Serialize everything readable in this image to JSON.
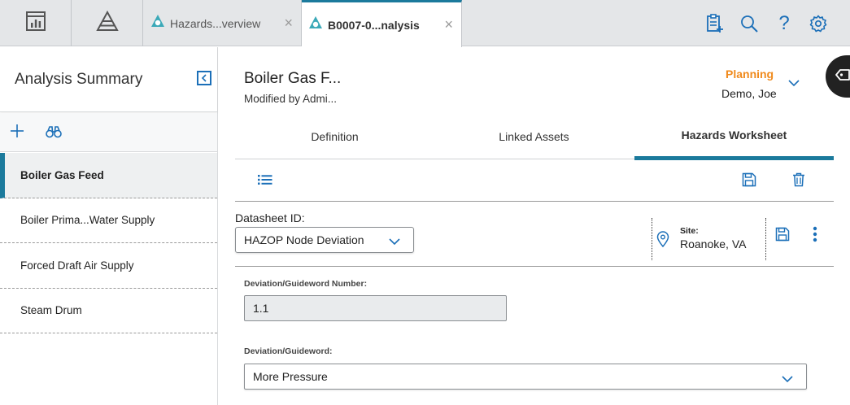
{
  "topbar": {
    "icon_tabs": [
      {
        "icon": "dashboard-icon"
      },
      {
        "icon": "hierarchy-icon"
      }
    ],
    "doc_tabs": [
      {
        "label": "Hazards...verview",
        "icon": "hazards-app-icon",
        "active": false
      },
      {
        "label": "B0007-0...nalysis",
        "icon": "hazards-app-icon",
        "active": true
      }
    ],
    "close_glyph": "×",
    "right_icons": [
      "add-report-icon",
      "search-icon",
      "help-icon",
      "gear-icon"
    ],
    "help_glyph": "?"
  },
  "left_panel": {
    "title": "Analysis Summary",
    "items": [
      {
        "label": "Boiler Gas Feed",
        "selected": true
      },
      {
        "label": "Boiler Prima...Water Supply",
        "selected": false
      },
      {
        "label": "Forced Draft Air Supply",
        "selected": false
      },
      {
        "label": "Steam Drum",
        "selected": false
      }
    ]
  },
  "record": {
    "title": "Boiler Gas F...",
    "subtitle": "Modified by Admi...",
    "state": "Planning",
    "state_user": "Demo, Joe"
  },
  "tabs": [
    {
      "label": "Definition",
      "active": false
    },
    {
      "label": "Linked Assets",
      "active": false
    },
    {
      "label": "Hazards Worksheet",
      "active": true
    }
  ],
  "datasheet": {
    "label": "Datasheet ID:",
    "value": "HAZOP Node Deviation",
    "site_label": "Site:",
    "site_value": "Roanoke, VA"
  },
  "fields": {
    "deviation_number_label": "Deviation/Guideword Number:",
    "deviation_number_value": "1.1",
    "deviation_label": "Deviation/Guideword:",
    "deviation_value": "More Pressure"
  },
  "colors": {
    "accent": "#1b7a9c",
    "link_blue": "#1b6fb8",
    "state_orange": "#f08a1c"
  }
}
